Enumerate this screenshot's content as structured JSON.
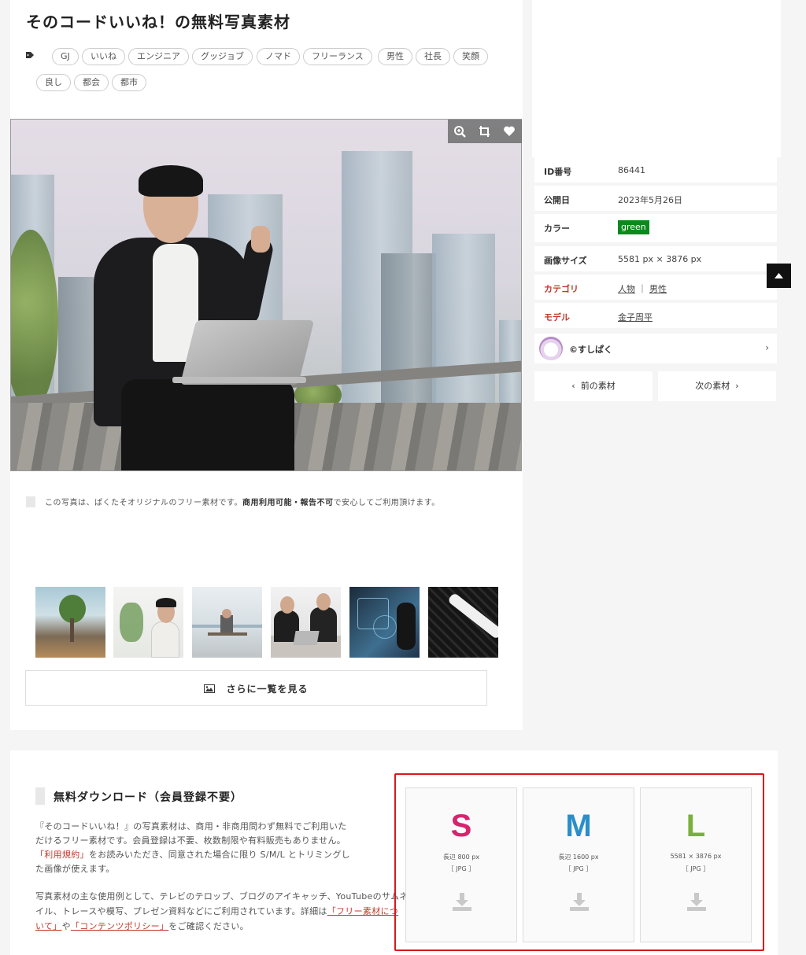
{
  "page": {
    "title": "そのコードいいね！の無料写真素材"
  },
  "tags": [
    "GJ",
    "いいね",
    "エンジニア",
    "グッジョブ",
    "ノマド",
    "フリーランス",
    "男性",
    "社長",
    "笑顔",
    "良し",
    "都会",
    "都市"
  ],
  "photo_tools": {
    "zoom": "zoom-in-icon",
    "crop": "crop-icon",
    "favorite": "heart-icon"
  },
  "notice": {
    "prefix": "この写真は、ぱくたそオリジナルのフリー素材です。",
    "bold": "商用利用可能・報告不可",
    "suffix": "で安心してご利用頂けます。"
  },
  "related": {
    "more_label": "さらに一覧を見る"
  },
  "info": {
    "id_label": "ID番号",
    "id_value": "86441",
    "date_label": "公開日",
    "date_value": "2023年5月26日",
    "color_label": "カラー",
    "color_value": "green",
    "color_hex": "#0a8a1e",
    "size_label": "画像サイズ",
    "size_value": "5581 px × 3876 px",
    "category_label": "カテゴリ",
    "category_1": "人物",
    "category_sep": "｜",
    "category_2": "男性",
    "model_label": "モデル",
    "model_value": "金子周平",
    "author": "©すしぱく",
    "prev": "前の素材",
    "next": "次の素材"
  },
  "download": {
    "title": "無料ダウンロード（会員登録不要）",
    "p1_line1": "『そのコードいいね！』の写真素材は、商用・非商用問わず無料でご利用いた",
    "p1_line2": "だけるフリー素材です。会員登録は不要、枚数制限や有料販売もありません。",
    "p1_line3_link": "「利用規約」",
    "p1_line3_rest": "をお読みいただき、同意された場合に限り S/M/L とトリミングし",
    "p1_line4": "た画像が使えます。",
    "p2_line1": "写真素材の主な使用例として、テレビのテロップ、ブログのアイキャッチ、YouTubeのサムネ",
    "p2_line2_pre": "イル、トレースや模写、プレゼン資料などにご利用されています。詳細は",
    "p2_line2_link": "「フリー素材につ",
    "p2_line3_link1": "いて」",
    "p2_line3_mid": "や",
    "p2_line3_link2": "「コンテンツポリシー」",
    "p2_line3_rest": "をご確認ください。",
    "sizes": [
      {
        "letter": "S",
        "dim": "長辺 800 px",
        "fmt": "［ JPG ］",
        "color": "#d6246e"
      },
      {
        "letter": "M",
        "dim": "長辺 1600 px",
        "fmt": "［ JPG ］",
        "color": "#2a8fc9"
      },
      {
        "letter": "L",
        "dim": "5581 × 3876 px",
        "fmt": "［ JPG ］",
        "color": "#7ab03a"
      }
    ]
  }
}
